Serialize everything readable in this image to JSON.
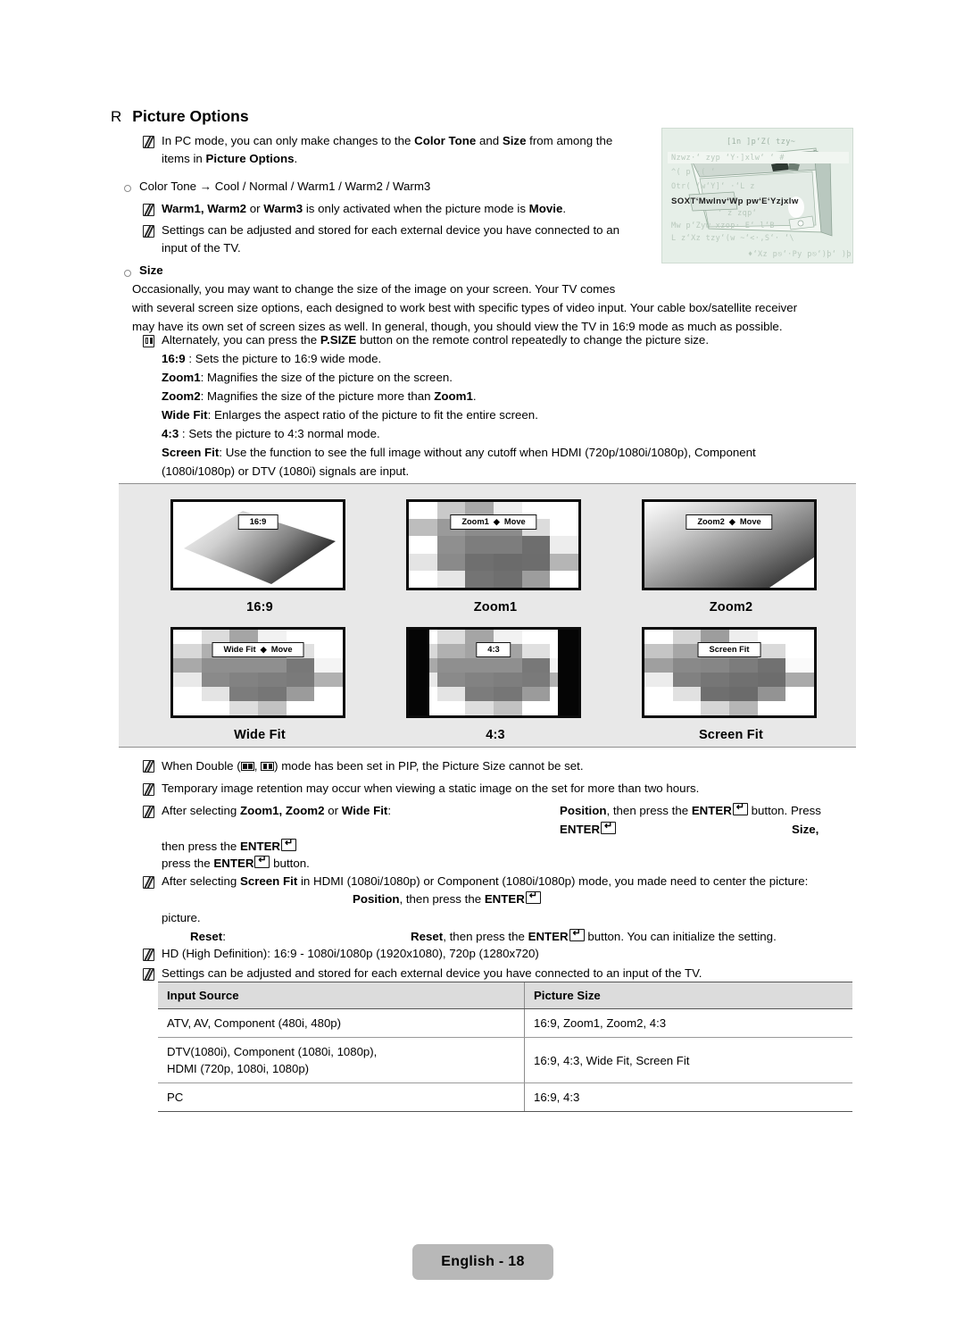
{
  "heading": {
    "marker": "R",
    "title": "Picture Options"
  },
  "notes_top": [
    {
      "pre": "In PC mode, you can only make changes to the ",
      "b1": "Color Tone",
      "mid": " and ",
      "b2": "Size",
      "post": " from among the",
      "line2_pre": "items in ",
      "line2_b": "Picture Options",
      "line2_post": "."
    }
  ],
  "color_tone": {
    "label": "Color Tone → Cool / Normal / Warm1 / Warm2 / Warm3",
    "notes": [
      {
        "b1": "Warm1, Warm2",
        "mid": " or ",
        "b2": "Warm3",
        "post": " is only activated when the picture mode is ",
        "b3": "Movie",
        "tail": "."
      },
      {
        "line1": "Settings can be adjusted and stored for each external device you have connected to an",
        "line2": "input of the TV."
      }
    ]
  },
  "size": {
    "label": "Size",
    "paragraph": [
      "Occasionally, you may want to change the size of the image on your screen. Your TV comes",
      "with several screen size options, each designed to work best with specific types of video input. Your cable box/satellite receiver",
      "may have its own set of screen sizes as well. In general, though, you should view the TV in 16:9 mode as much as possible."
    ],
    "alternately": {
      "pre": "Alternately, you can press the ",
      "b": "P.SIZE",
      "post": " button on the remote control repeatedly to change the picture size."
    },
    "modes": [
      {
        "term": "16:9",
        "sep": " : ",
        "desc": "Sets the picture to 16:9 wide mode."
      },
      {
        "term": "Zoom1",
        "sep": ": ",
        "desc": "Magnifies the size of the picture on the screen."
      },
      {
        "term": "Zoom2",
        "sep": ": ",
        "desc": "Magnifies the size of the picture more than ",
        "desc_b": "Zoom1",
        "desc_tail": "."
      },
      {
        "term": "Wide Fit",
        "sep": ": ",
        "desc": "Enlarges the aspect ratio of the picture to fit the entire screen."
      },
      {
        "term": "4:3",
        "sep": " : ",
        "desc": "Sets the picture to 4:3 normal mode."
      },
      {
        "term": "Screen Fit",
        "sep": ": ",
        "desc": "Use the function to see the full image without any cutoff when HDMI (720p/1080i/1080p), Component",
        "desc_line2": "(1080i/1080p) or DTV (1080i) signals are input."
      }
    ]
  },
  "samples": [
    {
      "caption": "16:9",
      "osd": "16:9",
      "has_move": false
    },
    {
      "caption": "Zoom1",
      "osd": "Zoom1",
      "has_move": true,
      "move": "Move"
    },
    {
      "caption": "Zoom2",
      "osd": "Zoom2",
      "has_move": true,
      "move": "Move"
    },
    {
      "caption": "Wide Fit",
      "osd": "Wide Fit",
      "has_move": true,
      "move": "Move"
    },
    {
      "caption": "4:3",
      "osd": "4:3",
      "has_move": false
    },
    {
      "caption": "Screen Fit",
      "osd": "Screen Fit",
      "has_move": false
    }
  ],
  "notes_bottom": {
    "double": {
      "pre": "When Double (",
      "sep": ", ",
      "post": ") mode has been set in PIP, the Picture Size cannot be set."
    },
    "retention": "Temporary image retention may occur when viewing a static image on the set for more than two hours.",
    "after_zoom": {
      "pre": "After selecting ",
      "b": "Zoom1, Zoom2",
      "mid": " or ",
      "b2": "Wide Fit",
      "colon": ":",
      "right_b": "Position",
      "right_mid": ", then press the ",
      "right_enter": "ENTER",
      "right_post": " button. Press",
      "l2_enter": "ENTER",
      "l2_right_b": "Size,",
      "l3_pre": "then press the ",
      "l3_enter": "ENTER",
      "l4_pre": "press the ",
      "l4_enter": "ENTER",
      "l4_post": " button."
    },
    "after_screenfit": {
      "pre": "After selecting ",
      "b": "Screen Fit",
      "post": " in HDMI (1080i/1080p) or Component (1080i/1080p) mode, you made need to center the picture:",
      "l2_b": "Position",
      "l2_mid": ", then press the ",
      "l2_enter": "ENTER",
      "l3": "picture."
    },
    "reset": {
      "label_b": "Reset",
      "label_colon": ":",
      "right_b": "Reset",
      "right_mid": ", then press the ",
      "right_enter": "ENTER",
      "right_post": " button. You can initialize the setting."
    },
    "hd": "HD (High Definition): 16:9 - 1080i/1080p (1920x1080), 720p (1280x720)",
    "stored": "Settings can be adjusted and stored for each external device you have connected to an input of the TV."
  },
  "table": {
    "headers": [
      "Input Source",
      "Picture Size"
    ],
    "rows": [
      {
        "source": "ATV, AV, Component (480i, 480p)",
        "source2": "",
        "size": "16:9, Zoom1, Zoom2, 4:3"
      },
      {
        "source": "DTV(1080i), Component (1080i, 1080p),",
        "source2": "HDMI (720p, 1080i, 1080p)",
        "size": "16:9, 4:3, Wide Fit, Screen Fit"
      },
      {
        "source": "PC",
        "source2": "",
        "size": "16:9, 4:3"
      }
    ]
  },
  "osd_illustration": {
    "lines": [
      "[1n  ]p‘Z( tzy~",
      "Nzwz·‘ zyp              ‘Y·]xlw‘   ‘     #",
      "^( p                           ·(  ‘",
      "Otr( (w‘Y]‘              ·‘L  z",
      "SOXT‘Mwlnv‘Wp pw‘E‘Yzjxlw",
      "                            ‘ z zqp‘",
      "Mw p‘Zyw  xzop·    E‘ l‘B",
      "L  z‘Xz tzy‘(w ~‘<·,S‘· ‘\\",
      "♦‘Xz p⎋‘·Py p⎋‘)þ‘ )þ"
    ]
  },
  "footer": {
    "page_label": "English - 18"
  },
  "colors": {
    "panel_bg": "#e8e8e8",
    "table_header_bg": "#dcdcdc",
    "footer_badge_bg": "#b8b8b8",
    "osd_illustration_bg": "#e6efe8",
    "text": "#000000"
  }
}
